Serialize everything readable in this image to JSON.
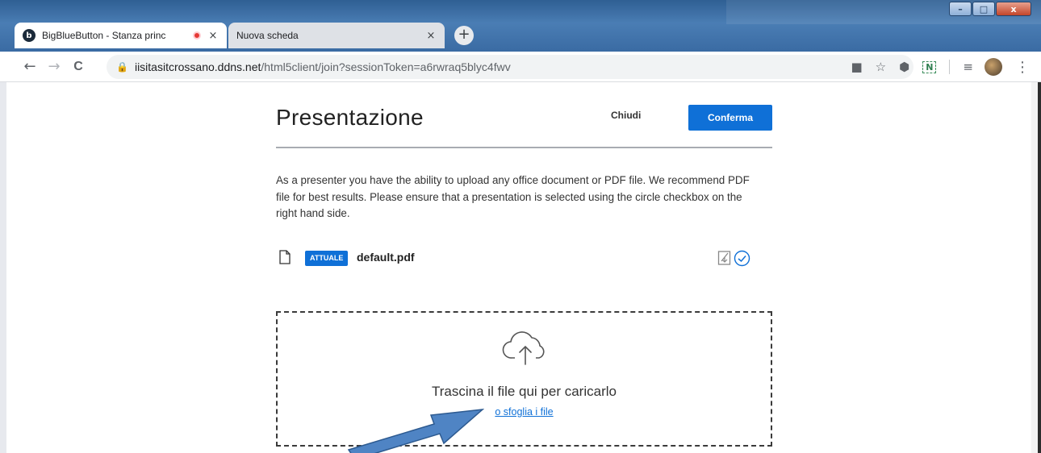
{
  "browser": {
    "tabs": [
      {
        "title": "BigBlueButton - Stanza princ",
        "favicon": "b",
        "active": true
      },
      {
        "title": "Nuova scheda",
        "active": false
      }
    ],
    "close_glyph": "×",
    "newtab_glyph": "+",
    "url_host": "iisitasitcrossano.ddns.net",
    "url_path": "/html5client/join?sessionToken=a6rwraq5blyc4fwv",
    "nav": {
      "back": "←",
      "forward": "→",
      "reload": "C"
    },
    "extensions": {
      "camera": "■",
      "star": "☆",
      "shield": "⬢",
      "n_badge": "N",
      "menu": "⋮",
      "queue": "≡"
    },
    "window_buttons": {
      "minimize": "–",
      "maximize": "□",
      "close": "x"
    },
    "colors": {
      "recording": "#e53935"
    }
  },
  "modal": {
    "title": "Presentazione",
    "close_label": "Chiudi",
    "confirm_label": "Conferma",
    "description": "As a presenter you have the ability to upload any office document or PDF file. We recommend PDF file for best results. Please ensure that a presentation is selected using the circle checkbox on the right hand side.",
    "file": {
      "badge": "ATTUALE",
      "name": "default.pdf"
    },
    "dropzone": {
      "text": "Trascina il file qui per caricarlo",
      "browse": "o sfoglia i file"
    },
    "colors": {
      "primary": "#0f70d7",
      "arrow": "#4f84c4"
    }
  }
}
